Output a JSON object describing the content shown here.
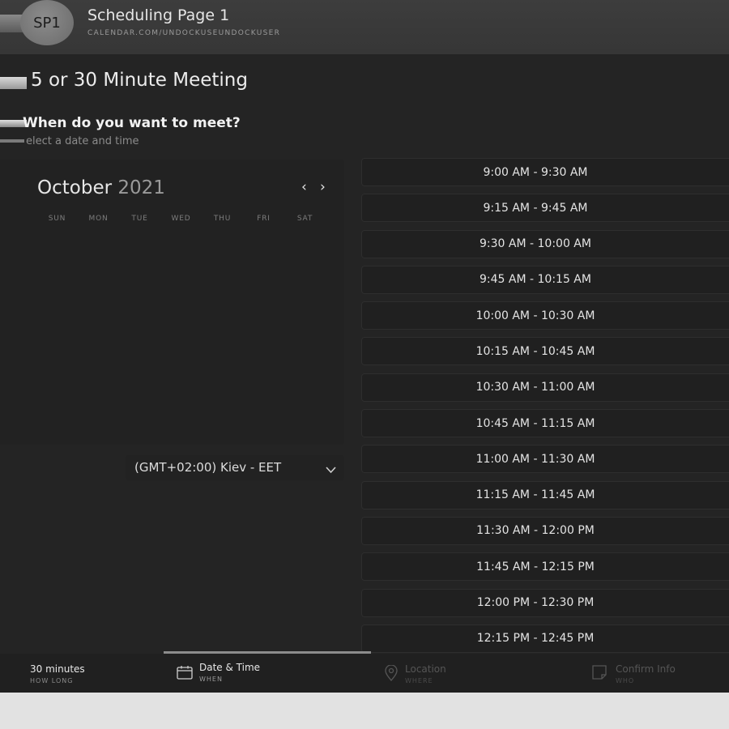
{
  "header": {
    "avatar_initials": "SP1",
    "title": "Scheduling Page 1",
    "url": "CALENDAR.COM/UNDOCKUSEUNDOCKUSER"
  },
  "event": {
    "title": "5 or 30 Minute Meeting",
    "question": "When do you want to meet?",
    "subtitle": "elect a date and time"
  },
  "calendar": {
    "month": "October",
    "year": "2021",
    "prev_icon": "chevron-left-icon",
    "next_icon": "chevron-right-icon",
    "weekdays": [
      "SUN",
      "MON",
      "TUE",
      "WED",
      "THU",
      "FRI",
      "SAT"
    ]
  },
  "timezone": {
    "selected": "(GMT+02:00) Kiev - EET",
    "icon": "chevron-down-icon"
  },
  "slots": [
    "9:00 AM - 9:30 AM",
    "9:15 AM - 9:45 AM",
    "9:30 AM - 10:00 AM",
    "9:45 AM - 10:15 AM",
    "10:00 AM - 10:30 AM",
    "10:15 AM - 10:45 AM",
    "10:30 AM - 11:00 AM",
    "10:45 AM - 11:15 AM",
    "11:00 AM - 11:30 AM",
    "11:15 AM - 11:45 AM",
    "11:30 AM - 12:00 PM",
    "11:45 AM - 12:15 PM",
    "12:00 PM - 12:30 PM",
    "12:15 PM - 12:45 PM"
  ],
  "bottom_nav": [
    {
      "label": "30 minutes",
      "sub": "HOW LONG",
      "icon": ""
    },
    {
      "label": "Date & Time",
      "sub": "WHEN",
      "icon": "calendar-icon"
    },
    {
      "label": "Location",
      "sub": "WHERE",
      "icon": "location-pin-icon"
    },
    {
      "label": "Confirm Info",
      "sub": "WHO",
      "icon": "note-icon"
    }
  ],
  "colors": {
    "background": "#242424",
    "header": "#3a3a3a",
    "panel": "#222222",
    "active_indicator": "#8c8c8c"
  }
}
